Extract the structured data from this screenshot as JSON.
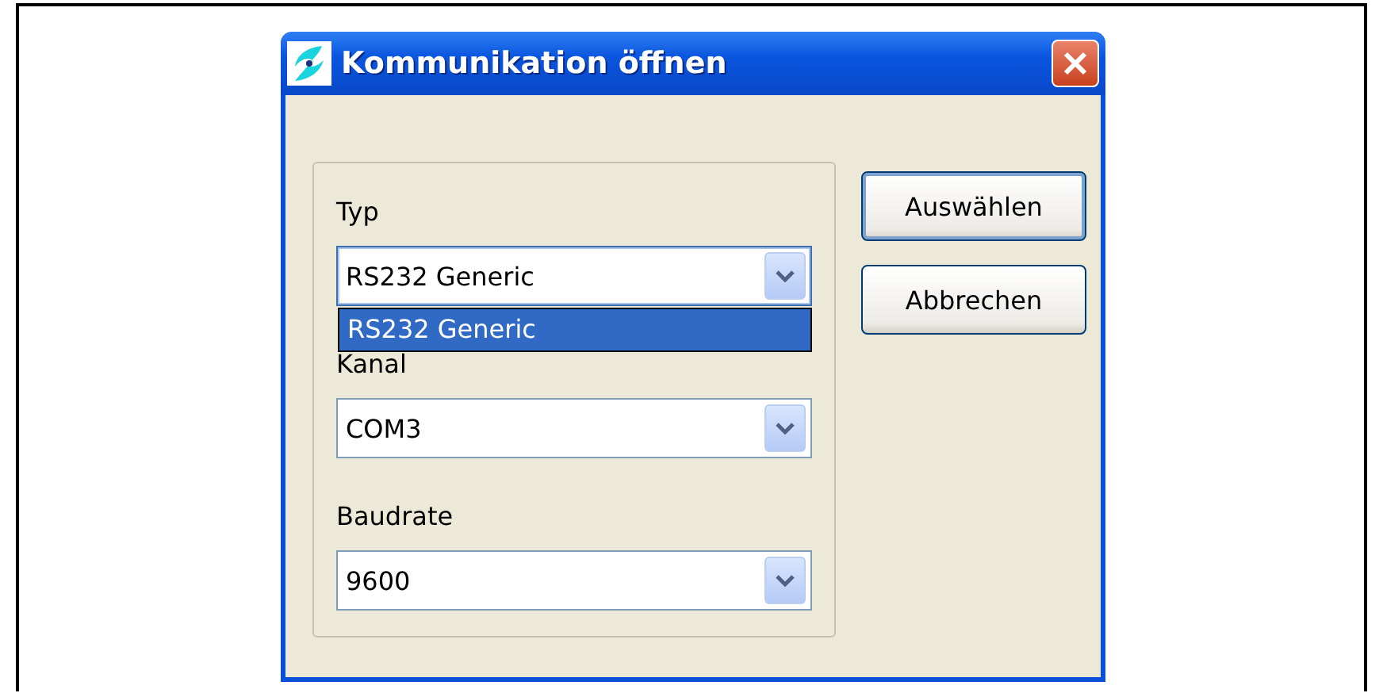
{
  "window": {
    "title": "Kommunikation öffnen"
  },
  "fields": [
    {
      "label": "Typ",
      "value": "RS232 Generic",
      "expanded": true,
      "options": [
        {
          "label": "RS232 Generic",
          "selected": true
        }
      ]
    },
    {
      "label": "Kanal",
      "value": "COM3",
      "expanded": false
    },
    {
      "label": "Baudrate",
      "value": "9600",
      "expanded": false
    }
  ],
  "buttons": [
    {
      "label": "Auswählen",
      "default": true
    },
    {
      "label": "Abbrechen",
      "default": false
    }
  ]
}
